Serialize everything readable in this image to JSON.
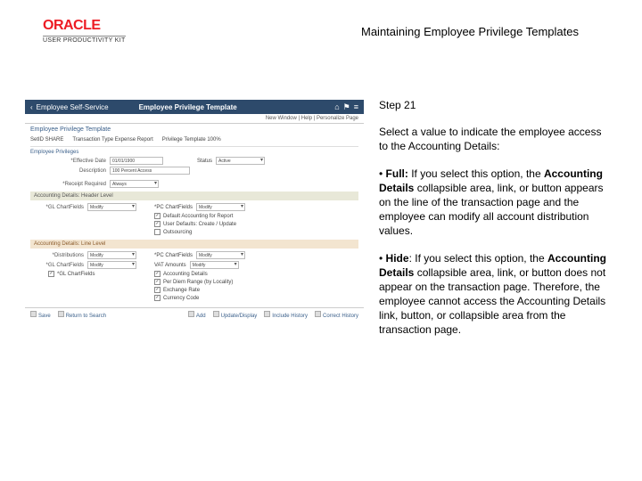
{
  "logo": {
    "brand": "ORACLE",
    "product": "USER PRODUCTIVITY KIT"
  },
  "doc_title": "Maintaining Employee Privilege Templates",
  "side": {
    "step": "Step 21",
    "intro": "Select a value to indicate the employee access to the Accounting Details:",
    "full_label": "Full:",
    "full_text": " If you select this option, the ",
    "full_text2": " collapsible area, link, or button appears on the line of the transaction page and the employee can modify all account distribution values.",
    "hide_label": "Hide",
    "hide_text": ": If you select this option, the ",
    "hide_text2": " collapsible area, link, or button does not appear on the transaction page. Therefore, the employee cannot access the Accounting Details link, button, or collapsible area from the transaction page.",
    "acc_details": "Accounting Details"
  },
  "ss": {
    "bar_back": "Employee Self-Service",
    "bar_title": "Employee Privilege Template",
    "sub": "New Window | Help | Personalize Page",
    "crumb": "Employee Privilege Template",
    "row1a": "SetID  SHARE",
    "row1b": "Transaction Type  Expense Report",
    "row1c": "Privilege Template  100%",
    "section1": "Employee Privileges",
    "eff_date": "*Effective Date",
    "eff_date_val": "01/01/1900",
    "status": "Status",
    "status_val": "Active",
    "desc": "Description",
    "desc_val": "100 Percent Access",
    "receipt": "*Receipt Required",
    "receipt_val": "Always",
    "banner1": "Accounting Details: Header Level",
    "gl": "*GL ChartFields",
    "gl_val": "Modify",
    "pc": "*PC ChartFields",
    "pc_val": "Modify",
    "ck1": "Default Accounting for Report",
    "ck2": "User Defaults: Create / Update",
    "ck3": "Outsourcing",
    "banner2": "Accounting Details: Line Level",
    "distrib": "*Distributions",
    "distrib_val": "Modify",
    "vat": "VAT Amounts",
    "vat_val": "Modify",
    "line_gl": "*GL ChartFields",
    "line_gl_val": "Modify",
    "line_pc": "*PC ChartFields",
    "line_pc_val": "Modify",
    "ck4": "Accounting Details",
    "ck5": "Per Diem Range (by Locality)",
    "ck6": "Exchange Rate",
    "ck7": "Currency Code",
    "foot_save": "Save",
    "foot_return": "Return to Search",
    "foot_add": "Add",
    "foot_update": "Update/Display",
    "foot_hist": "Include History",
    "foot_correct": "Correct History"
  }
}
